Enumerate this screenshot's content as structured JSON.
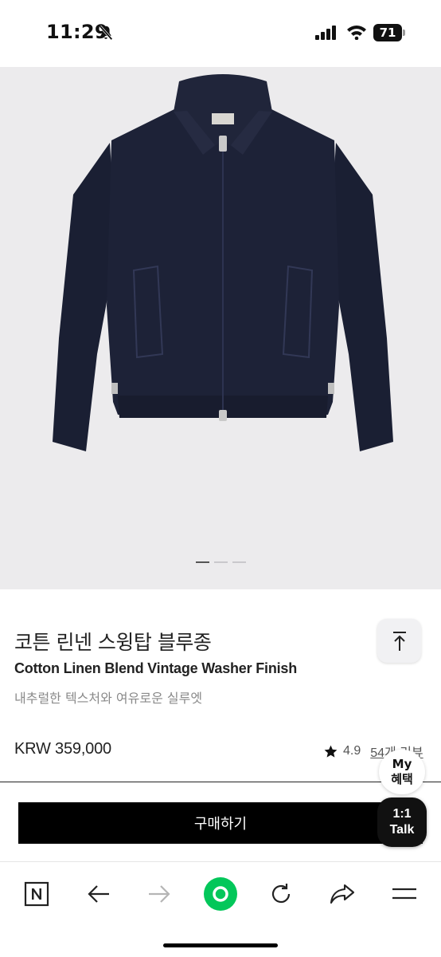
{
  "status_bar": {
    "time": "11:29",
    "battery": "71"
  },
  "product": {
    "name_ko": "코튼 린넨 스윙탑 블루종",
    "name_en": "Cotton Linen Blend Vintage Washer Finish",
    "description": "내추럴한 텍스처와 여유로운 실루엣",
    "price": "KRW 359,000",
    "rating": "4.9",
    "review_count": "54개 리뷰",
    "image_pages": 3,
    "active_image_page": 1
  },
  "actions": {
    "buy_label": "구매하기",
    "my_benefit_line1": "My",
    "my_benefit_line2": "혜택",
    "talk_line1": "1:1",
    "talk_line2": "Talk"
  },
  "toolbar": {
    "items": [
      "naver-home-icon",
      "back-arrow-icon",
      "forward-arrow-icon",
      "green-dot-icon",
      "refresh-icon",
      "share-icon",
      "menu-icon"
    ]
  },
  "colors": {
    "accent_green": "#03c75a",
    "jacket_navy": "#1d2237",
    "image_bg": "#ecebed"
  }
}
